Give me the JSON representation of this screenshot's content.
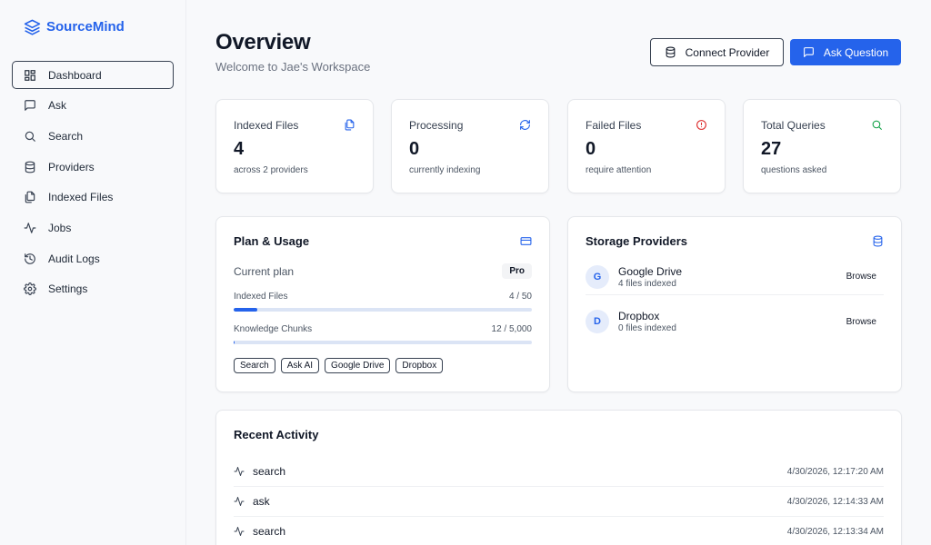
{
  "brand": {
    "name": "SourceMind",
    "icon": "layers-icon"
  },
  "sidebar": {
    "items": [
      {
        "label": "Dashboard",
        "icon": "dashboard-icon",
        "active": true
      },
      {
        "label": "Ask",
        "icon": "message-icon"
      },
      {
        "label": "Search",
        "icon": "search-icon"
      },
      {
        "label": "Providers",
        "icon": "database-icon"
      },
      {
        "label": "Indexed Files",
        "icon": "files-icon"
      },
      {
        "label": "Jobs",
        "icon": "activity-icon"
      },
      {
        "label": "Audit Logs",
        "icon": "history-icon"
      },
      {
        "label": "Settings",
        "icon": "gear-icon"
      }
    ]
  },
  "header": {
    "title": "Overview",
    "subtitle": "Welcome to Jae's Workspace",
    "connect_label": "Connect Provider",
    "ask_label": "Ask Question"
  },
  "stats": [
    {
      "label": "Indexed Files",
      "value": "4",
      "sub": "across 2 providers",
      "icon": "files-icon",
      "color": "#2563eb"
    },
    {
      "label": "Processing",
      "value": "0",
      "sub": "currently indexing",
      "icon": "refresh-icon",
      "color": "#2563eb"
    },
    {
      "label": "Failed Files",
      "value": "0",
      "sub": "require attention",
      "icon": "alert-icon",
      "color": "#dc2626"
    },
    {
      "label": "Total Queries",
      "value": "27",
      "sub": "questions asked",
      "icon": "search-icon",
      "color": "#16a34a"
    }
  ],
  "plan": {
    "title": "Plan & Usage",
    "current_label": "Current plan",
    "plan_name": "Pro",
    "indexed_label": "Indexed Files",
    "indexed_value": "4 / 50",
    "indexed_fraction": 0.08,
    "chunks_label": "Knowledge Chunks",
    "chunks_value": "12 / 5,000",
    "chunks_fraction": 0.0024,
    "features": [
      "Search",
      "Ask AI",
      "Google Drive",
      "Dropbox"
    ]
  },
  "storage": {
    "title": "Storage Providers",
    "providers": [
      {
        "initial": "G",
        "name": "Google Drive",
        "meta": "4 files indexed",
        "action": "Browse"
      },
      {
        "initial": "D",
        "name": "Dropbox",
        "meta": "0 files indexed",
        "action": "Browse"
      }
    ]
  },
  "activity": {
    "title": "Recent Activity",
    "items": [
      {
        "action": "search",
        "time": "4/30/2026, 12:17:20 AM"
      },
      {
        "action": "ask",
        "time": "4/30/2026, 12:14:33 AM"
      },
      {
        "action": "search",
        "time": "4/30/2026, 12:13:34 AM"
      }
    ]
  },
  "colors": {
    "accent": "#2563eb",
    "danger": "#dc2626",
    "success": "#16a34a"
  }
}
